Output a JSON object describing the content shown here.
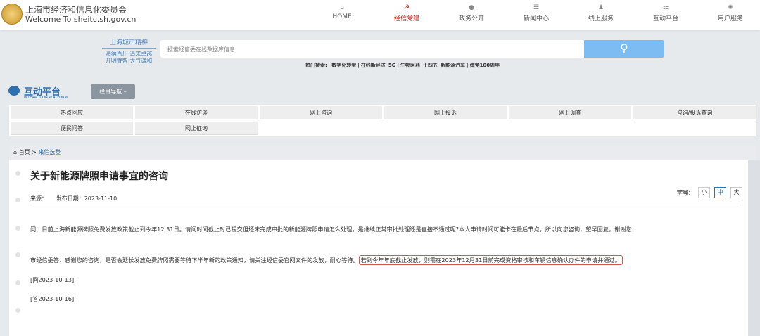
{
  "header": {
    "org_cn": "上海市经济和信息化委员会",
    "org_en": "Welcome To sheitc.sh.gov.cn",
    "nav": [
      {
        "label": "HOME",
        "icon": "home-icon"
      },
      {
        "label": "经信党建",
        "icon": "party-icon",
        "active": true
      },
      {
        "label": "政务公开",
        "icon": "chat-icon"
      },
      {
        "label": "新闻中心",
        "icon": "news-icon"
      },
      {
        "label": "线上服务",
        "icon": "user-service-icon"
      },
      {
        "label": "互动平台",
        "icon": "platform-icon"
      },
      {
        "label": "用户服务",
        "icon": "gear-icon"
      }
    ]
  },
  "spirit": {
    "title": "上海城市精神",
    "line1": "海纳百川 追求卓越",
    "line2": "开明睿智 大气谦和"
  },
  "search": {
    "placeholder": "搜索经信委在线数据库信息",
    "hot_label": "热门搜索:",
    "hot": [
      "数字化转型",
      "在线新经济",
      "5G",
      "生物医药",
      "十四五",
      "新能源汽车",
      "建党100周年"
    ]
  },
  "platform": {
    "title": "互动平台",
    "subtitle": "INTERACTION PLATFORM",
    "column_nav": "栏目导航 –"
  },
  "menu": [
    "热点回应",
    "在线访谈",
    "网上咨询",
    "网上投诉",
    "网上调查",
    "咨询/投诉查询",
    "便民问答",
    "网上征询"
  ],
  "breadcrumb": {
    "home": "首页",
    "sep": ">",
    "current": "来信选登"
  },
  "article": {
    "title": "关于新能源牌照申请事宜的咨询",
    "source_label": "来源：",
    "date_label": "发布日期：2023-11-10",
    "font_label": "字号：",
    "font_sizes": [
      "小",
      "中",
      "大"
    ],
    "question": "问：目前上海新能源牌照免费发放政策截止到今年12.31日。请问时间截止时已提交但还未完成审批的新能源牌照申请怎么处理，是继续正常审批处理还是直接不通过呢?本人申请时间可能卡在最后节点，所以向您咨询，望早回复，谢谢您!",
    "answer": "市经信委答：感谢您的咨询，是否会延长发放免费牌照需要等待下半年新的政策通知，请关注经信委官网文件的发放，耐心等待。",
    "answer_highlight": "若到今年年底截止发放，则需在2023年12月31日前完成资格审核和车辆信息确认办件的申请并通过。",
    "q_date": "[问2023-10-13]",
    "a_date": "[答2023-10-16]"
  }
}
